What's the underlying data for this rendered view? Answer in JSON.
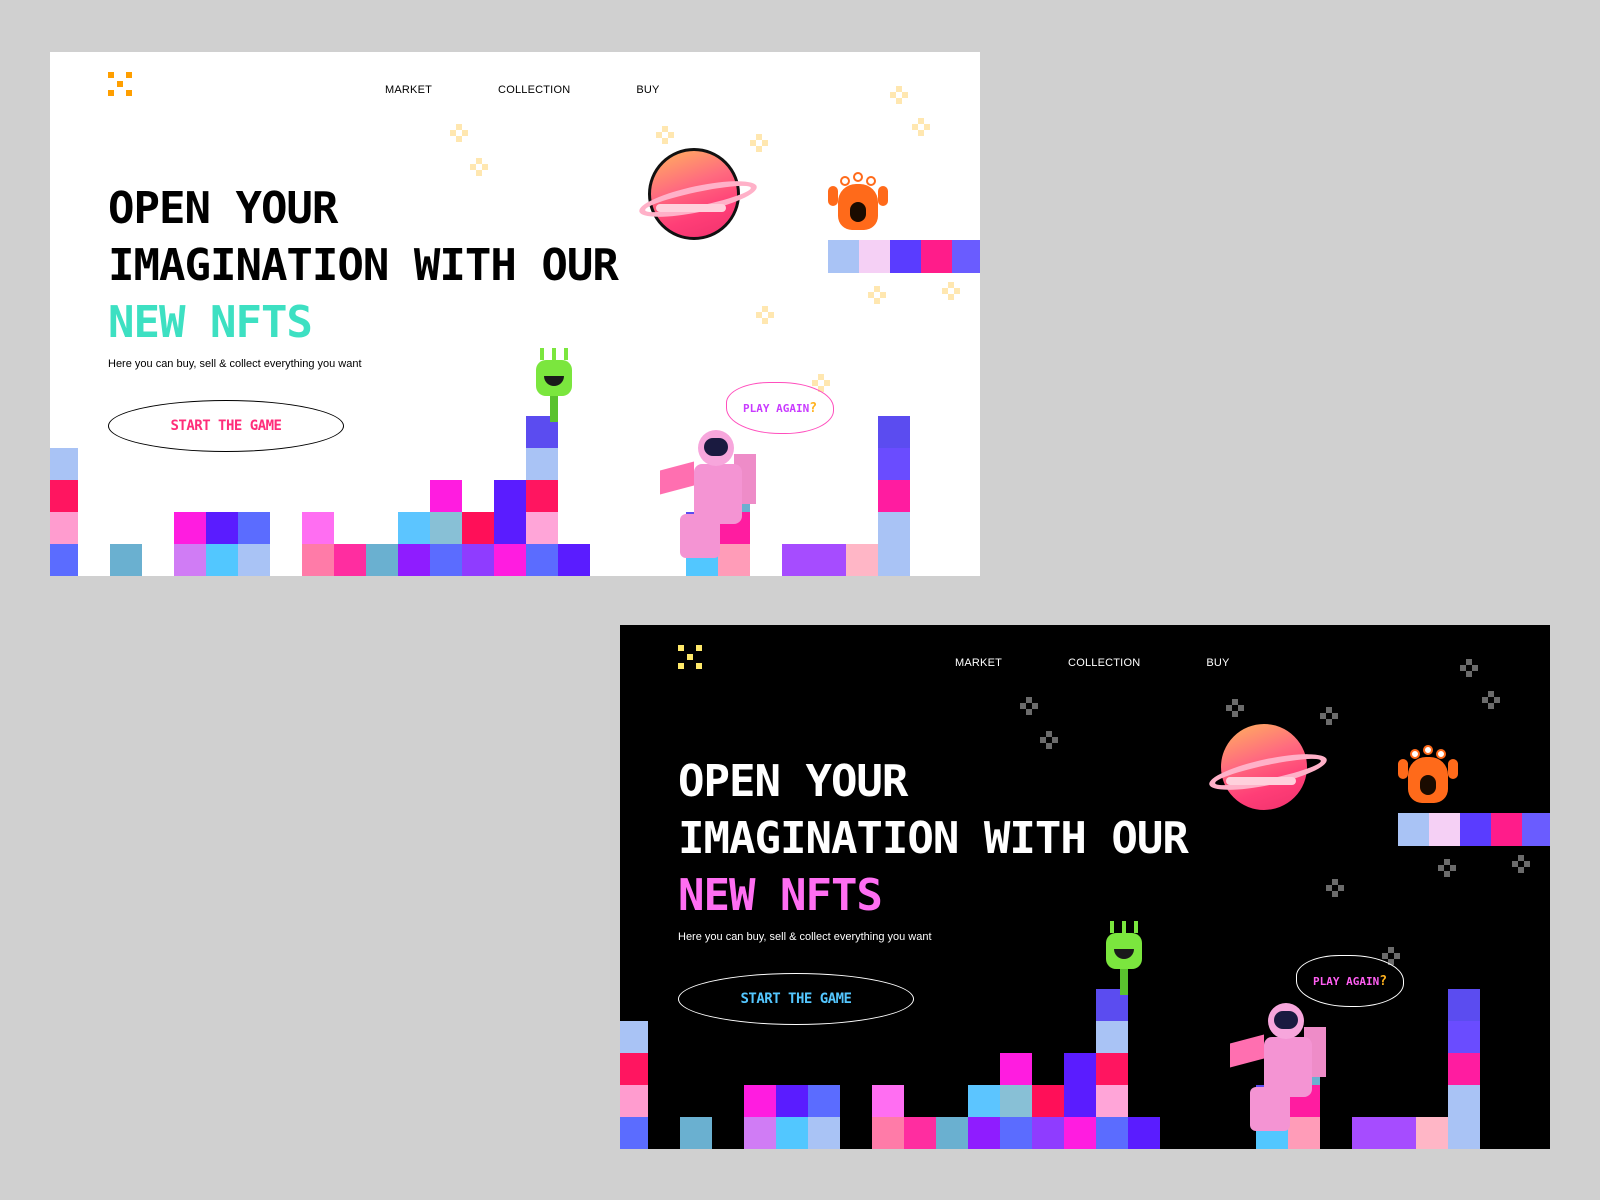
{
  "light": {
    "nav": [
      "MARKET",
      "COLLECTION",
      "BUY"
    ],
    "headline_line1": "OPEN YOUR",
    "headline_line2": "IMAGINATION WITH OUR",
    "headline_accent": "NEW NFTS",
    "subtitle": "Here you can buy, sell & collect everything you want",
    "cta": "START THE GAME",
    "bubble": "PLAY AGAIN",
    "bubble_mark": "?"
  },
  "dark": {
    "nav": [
      "MARKET",
      "COLLECTION",
      "BUY"
    ],
    "headline_line1": "OPEN YOUR",
    "headline_line2": "IMAGINATION WITH OUR",
    "headline_accent": "NEW NFTS",
    "subtitle": "Here you can buy, sell & collect everything you want",
    "cta": "START THE GAME",
    "bubble": "PLAY AGAIN",
    "bubble_mark": "?"
  },
  "colors": {
    "light_bg": "#ffffff",
    "dark_bg": "#000000",
    "page_bg": "#d0d0d0",
    "light_accent": "#3de0c2",
    "dark_accent": "#ff6ef2",
    "light_cta_text": "#ff2d7a",
    "dark_cta_text": "#54c7ff"
  },
  "icons": {
    "logo": "pixel-x-logo-icon",
    "planet": "planet-icon",
    "monster": "orange-monster-icon",
    "alien": "green-alien-icon",
    "astronaut": "astronaut-icon"
  }
}
